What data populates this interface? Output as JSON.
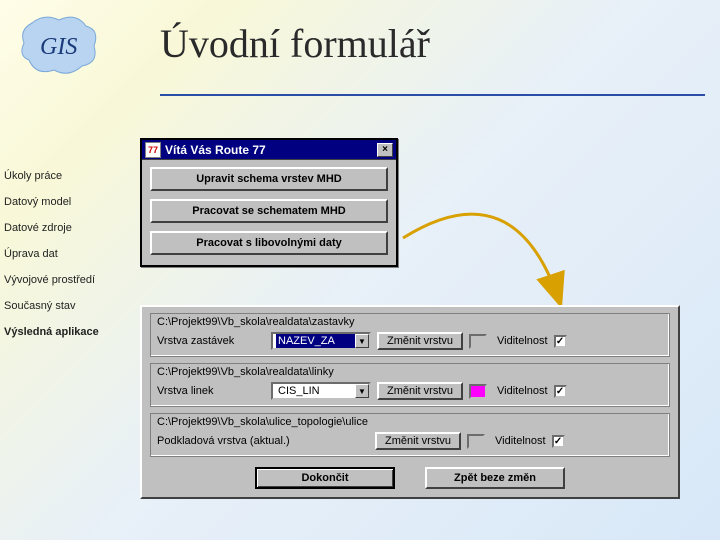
{
  "page": {
    "title": "Úvodní formulář"
  },
  "sidebar": {
    "items": [
      {
        "label": "Úkoly práce",
        "bold": false
      },
      {
        "label": "Datový model",
        "bold": false
      },
      {
        "label": "Datové zdroje",
        "bold": false
      },
      {
        "label": "Úprava dat",
        "bold": false
      },
      {
        "label": "Vývojové prostředí",
        "bold": false
      },
      {
        "label": "Současný stav",
        "bold": false
      },
      {
        "label": "Výsledná aplikace",
        "bold": true
      }
    ]
  },
  "dialog1": {
    "icon_label": "77",
    "title": "Vítá Vás Route 77",
    "close": "×",
    "buttons": [
      "Upravit schema vrstev MHD",
      "Pracovat se schematem MHD",
      "Pracovat s libovolnými daty"
    ]
  },
  "dialog2": {
    "groups": [
      {
        "path": "C:\\Projekt99\\Vb_skola\\realdata\\zastavky",
        "label": "Vrstva zastávek",
        "value": "NAZEV_ZA",
        "has_dropdown": true,
        "highlighted": true,
        "change": "Změnit vrstvu",
        "swatch": "#c0c0c0",
        "vis_label": "Viditelnost",
        "checked": true
      },
      {
        "path": "C:\\Projekt99\\Vb_skola\\realdata\\linky",
        "label": "Vrstva linek",
        "value": "CIS_LIN",
        "has_dropdown": true,
        "highlighted": false,
        "change": "Změnit vrstvu",
        "swatch": "#ff00ff",
        "vis_label": "Viditelnost",
        "checked": true
      },
      {
        "path": "C:\\Projekt99\\Vb_skola\\ulice_topologie\\ulice",
        "label": "Podkladová vrstva (aktual.)",
        "value": "",
        "has_dropdown": false,
        "highlighted": false,
        "change": "Změnit vrstvu",
        "swatch": "#c0c0c0",
        "vis_label": "Viditelnost",
        "checked": true
      }
    ],
    "footer": {
      "ok": "Dokončit",
      "cancel": "Zpět beze změn"
    }
  }
}
